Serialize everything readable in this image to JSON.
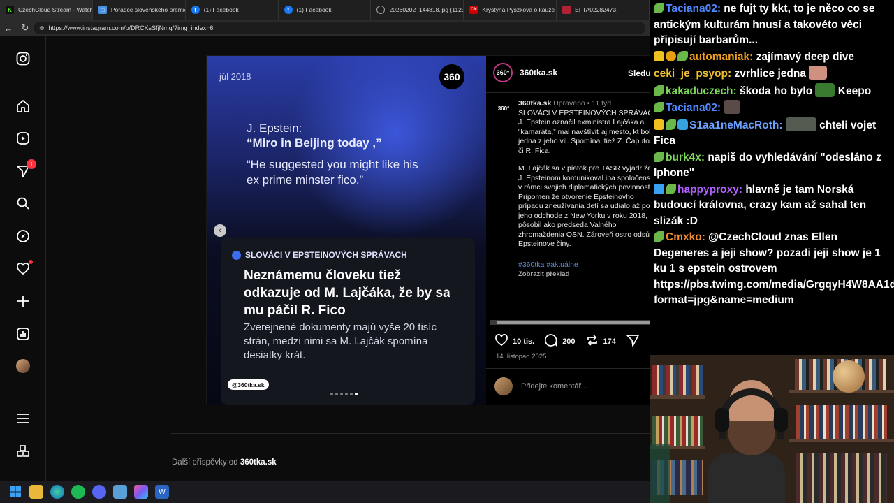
{
  "browser": {
    "tabs": [
      {
        "label": "CzechCloud Stream - Watch l",
        "icon": "kick-icon",
        "color": "#53fc18"
      },
      {
        "label": "Poradce slovenského premiér",
        "icon": "site-icon",
        "color": "#4a90e2"
      },
      {
        "label": "(1) Facebook",
        "icon": "facebook-icon",
        "color": "#1877f2"
      },
      {
        "label": "(1) Facebook",
        "icon": "facebook-icon",
        "color": "#1877f2"
      },
      {
        "label": "20260202_144818.jpg (1123×",
        "icon": "globe-icon",
        "color": "#9aa0a6"
      },
      {
        "label": "Krystyna Pyszková o kauze Ep",
        "icon": "news-icon",
        "color": "#cc0000"
      },
      {
        "label": "EFTA02282473.",
        "icon": "doj-icon",
        "color": "#b22234"
      }
    ],
    "url": "https://www.instagram.com/p/DRCKsSfjNmq/?img_index=6"
  },
  "nav": {
    "notifications_count": "1"
  },
  "post": {
    "image": {
      "date_label": "júl 2018",
      "logo": "360",
      "quote_name": "J. Epstein:",
      "quote_line1": "“Miro in Beijing today ,”",
      "quote_line2": "“He suggested you might like his",
      "quote_line3": "ex prime minster fico.”",
      "kicker": "SLOVÁCI V EPSTEINOVÝCH SPRÁVACH",
      "headline": "Neznámemu človeku tiež odkazuje od M. Lajčáka, že by sa mu páčil R. Fico",
      "subtext": "Zverejnené dokumenty majú vyše 20 tisíc strán, medzi nimi sa M. Lajčák spomína desiatky krát.",
      "handle": "@360tka.sk",
      "slide_count": 6,
      "active_slide": 6
    },
    "author": "360tka.sk",
    "follow": "Sledu",
    "caption": {
      "author": "360tka.sk",
      "edited": "Upraveno",
      "age": "11 týd.",
      "title": "SLOVÁCI V EPSTEINOVÝCH SPRÁVAC",
      "p1": "J. Epstein označil exministra Lajčáka a “kamaráta,” mal navštíviť aj mesto, kt bola jedna z jeho vil. Spomínal tiež Z. Čaputovú či R. Fica.",
      "p2": "M. Lajčák sa v piatok pre TASR vyjadr že s J. Epsteinom komunikoval iba spoločensky v rámci svojich diplomatických povinností. Pripomen že otvorenie Epsteinovho prípadu zneužívania detí sa udialo až po jeho odchode z New Yorku v roku 2018, k pôsobil ako predseda Valného zhromaždenia OSN. Zároveň ostro odsúdil Epsteinove činy.",
      "tags": "#360tka #aktuálne",
      "translate": "Zobrazit překlad"
    },
    "likes": "10 tis.",
    "comments": "200",
    "reposts": "174",
    "date": "14. listopad 2025",
    "comment_placeholder": "Přidejte komentář...",
    "more_prefix": "Další příspěvky od",
    "more_author": "360tka.sk"
  },
  "chat": [
    {
      "badges": [
        "leaf"
      ],
      "user": "Taciana02",
      "color": "#4f88ff",
      "text": "ne fujt ty kkt, to je něco co se antickým kulturám hnusí a takovéto věci připisují barbarům..."
    },
    {
      "badges": [
        "crown",
        "one",
        "leaf"
      ],
      "user": "automaniak",
      "color": "#f0a020",
      "text": "zajímavý deep dive"
    },
    {
      "badges": [],
      "user": "ceki_je_psyop",
      "color": "#f0c030",
      "text": "zvrhlice jedna",
      "emote": "pic-face"
    },
    {
      "badges": [
        "leaf"
      ],
      "user": "kakaduczech",
      "color": "#7ddb5a",
      "text": "škoda ho bylo",
      "emote": "frog",
      "after": "Keepo"
    },
    {
      "badges": [
        "leaf"
      ],
      "user": "Taciana02",
      "color": "#4f88ff",
      "text": "",
      "emote": "pic"
    },
    {
      "badges": [
        "crown",
        "leaf",
        "cube"
      ],
      "user": "S1aa1neMacRoth",
      "color": "#6aa0ff",
      "text": "chteli vojet Fica",
      "emote": "wide"
    },
    {
      "badges": [
        "leaf"
      ],
      "user": "burk4x",
      "color": "#7ddb5a",
      "text": "napiš do vyhledávání \"odesláno z Iphone\""
    },
    {
      "badges": [
        "bolt",
        "leaf"
      ],
      "user": "happyproxy",
      "color": "#b060ff",
      "text": "hlavně je tam Norská budoucí královna, crazy kam až sahal ten slizák :D"
    },
    {
      "badges": [
        "leaf"
      ],
      "user": "Cmxko",
      "color": "#f08a30",
      "text": "@CzechCloud znas Ellen Degeneres a jeji show? pozadi jeji show je 1 ku 1 s epstein ostrovem https://pbs.twimg.com/media/GrgqyH4W8AA1dpP?format=jpg&name=medium"
    }
  ],
  "taskbar": [
    "windows-icon",
    "file-explorer-icon",
    "edge-icon",
    "spotify-icon",
    "discord-icon",
    "notepad-icon",
    "copilot-icon",
    "word-icon"
  ]
}
